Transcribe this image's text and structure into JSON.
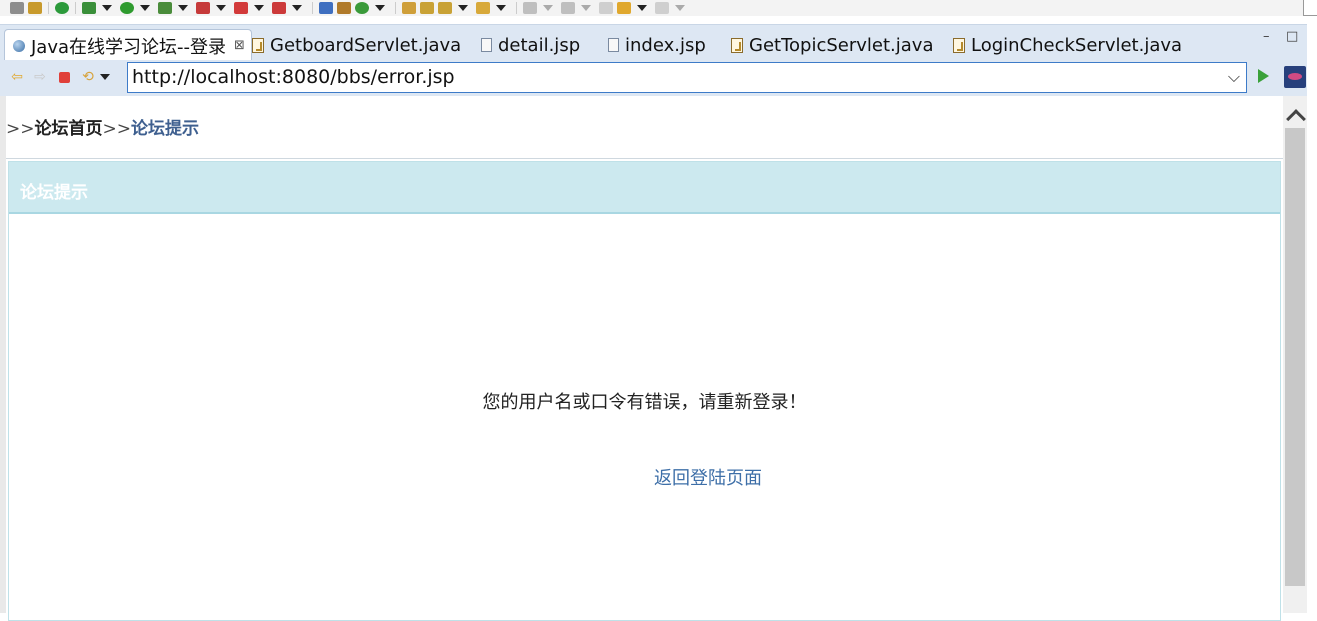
{
  "toolbar": {
    "icon_colors": [
      "#8d8d8d",
      "#c89a2c",
      "#2c9a3b",
      "#3a8f3a",
      "#2f9b2f",
      "#4a8c3b",
      "#c63a3a",
      "#d23a3a",
      "#cc3a3a",
      "#3f6fc0",
      "#b07a2a",
      "#3a9a3a",
      "#cf9f3a",
      "#c9a236",
      "#c9a236",
      "#d8a93a",
      "#bfbfbf",
      "#bfbfbf",
      "#cfcfcf",
      "#e0a82e",
      "#cfcfcf"
    ]
  },
  "tabs": [
    {
      "label": "Java在线学习论坛--登录",
      "icon": "globe-icon",
      "active": true,
      "close": "⊠"
    },
    {
      "label": "GetboardServlet.java",
      "icon": "java-file-icon"
    },
    {
      "label": "detail.jsp",
      "icon": "file-icon"
    },
    {
      "label": "index.jsp",
      "icon": "file-icon"
    },
    {
      "label": "GetTopicServlet.java",
      "icon": "java-file-icon"
    },
    {
      "label": "LoginCheckServlet.java",
      "icon": "java-file-icon"
    }
  ],
  "window_controls": {
    "minimize": "–",
    "maximize": "□"
  },
  "address_bar": {
    "url": "http://localhost:8080/bbs/error.jsp",
    "back_icon": "back-arrow-icon",
    "forward_icon": "forward-arrow-icon",
    "stop_icon": "stop-icon",
    "refresh_icon": "refresh-icon",
    "go_icon": "go-icon",
    "browser_icon": "browser-icon"
  },
  "breadcrumb": {
    "sep1": ">>",
    "home": "论坛首页",
    "sep2": ">>",
    "current": "论坛提示"
  },
  "panel": {
    "title": "论坛提示",
    "message": "您的用户名或口令有错误，请重新登录！",
    "back_link": "返回登陆页面"
  },
  "colors": {
    "tab_strip": "#dde7f3",
    "panel_header": "#cce9ef",
    "link": "#3e6fa8",
    "breadcrumb_current": "#3e5f8f",
    "url_border": "#3d7bc8"
  }
}
